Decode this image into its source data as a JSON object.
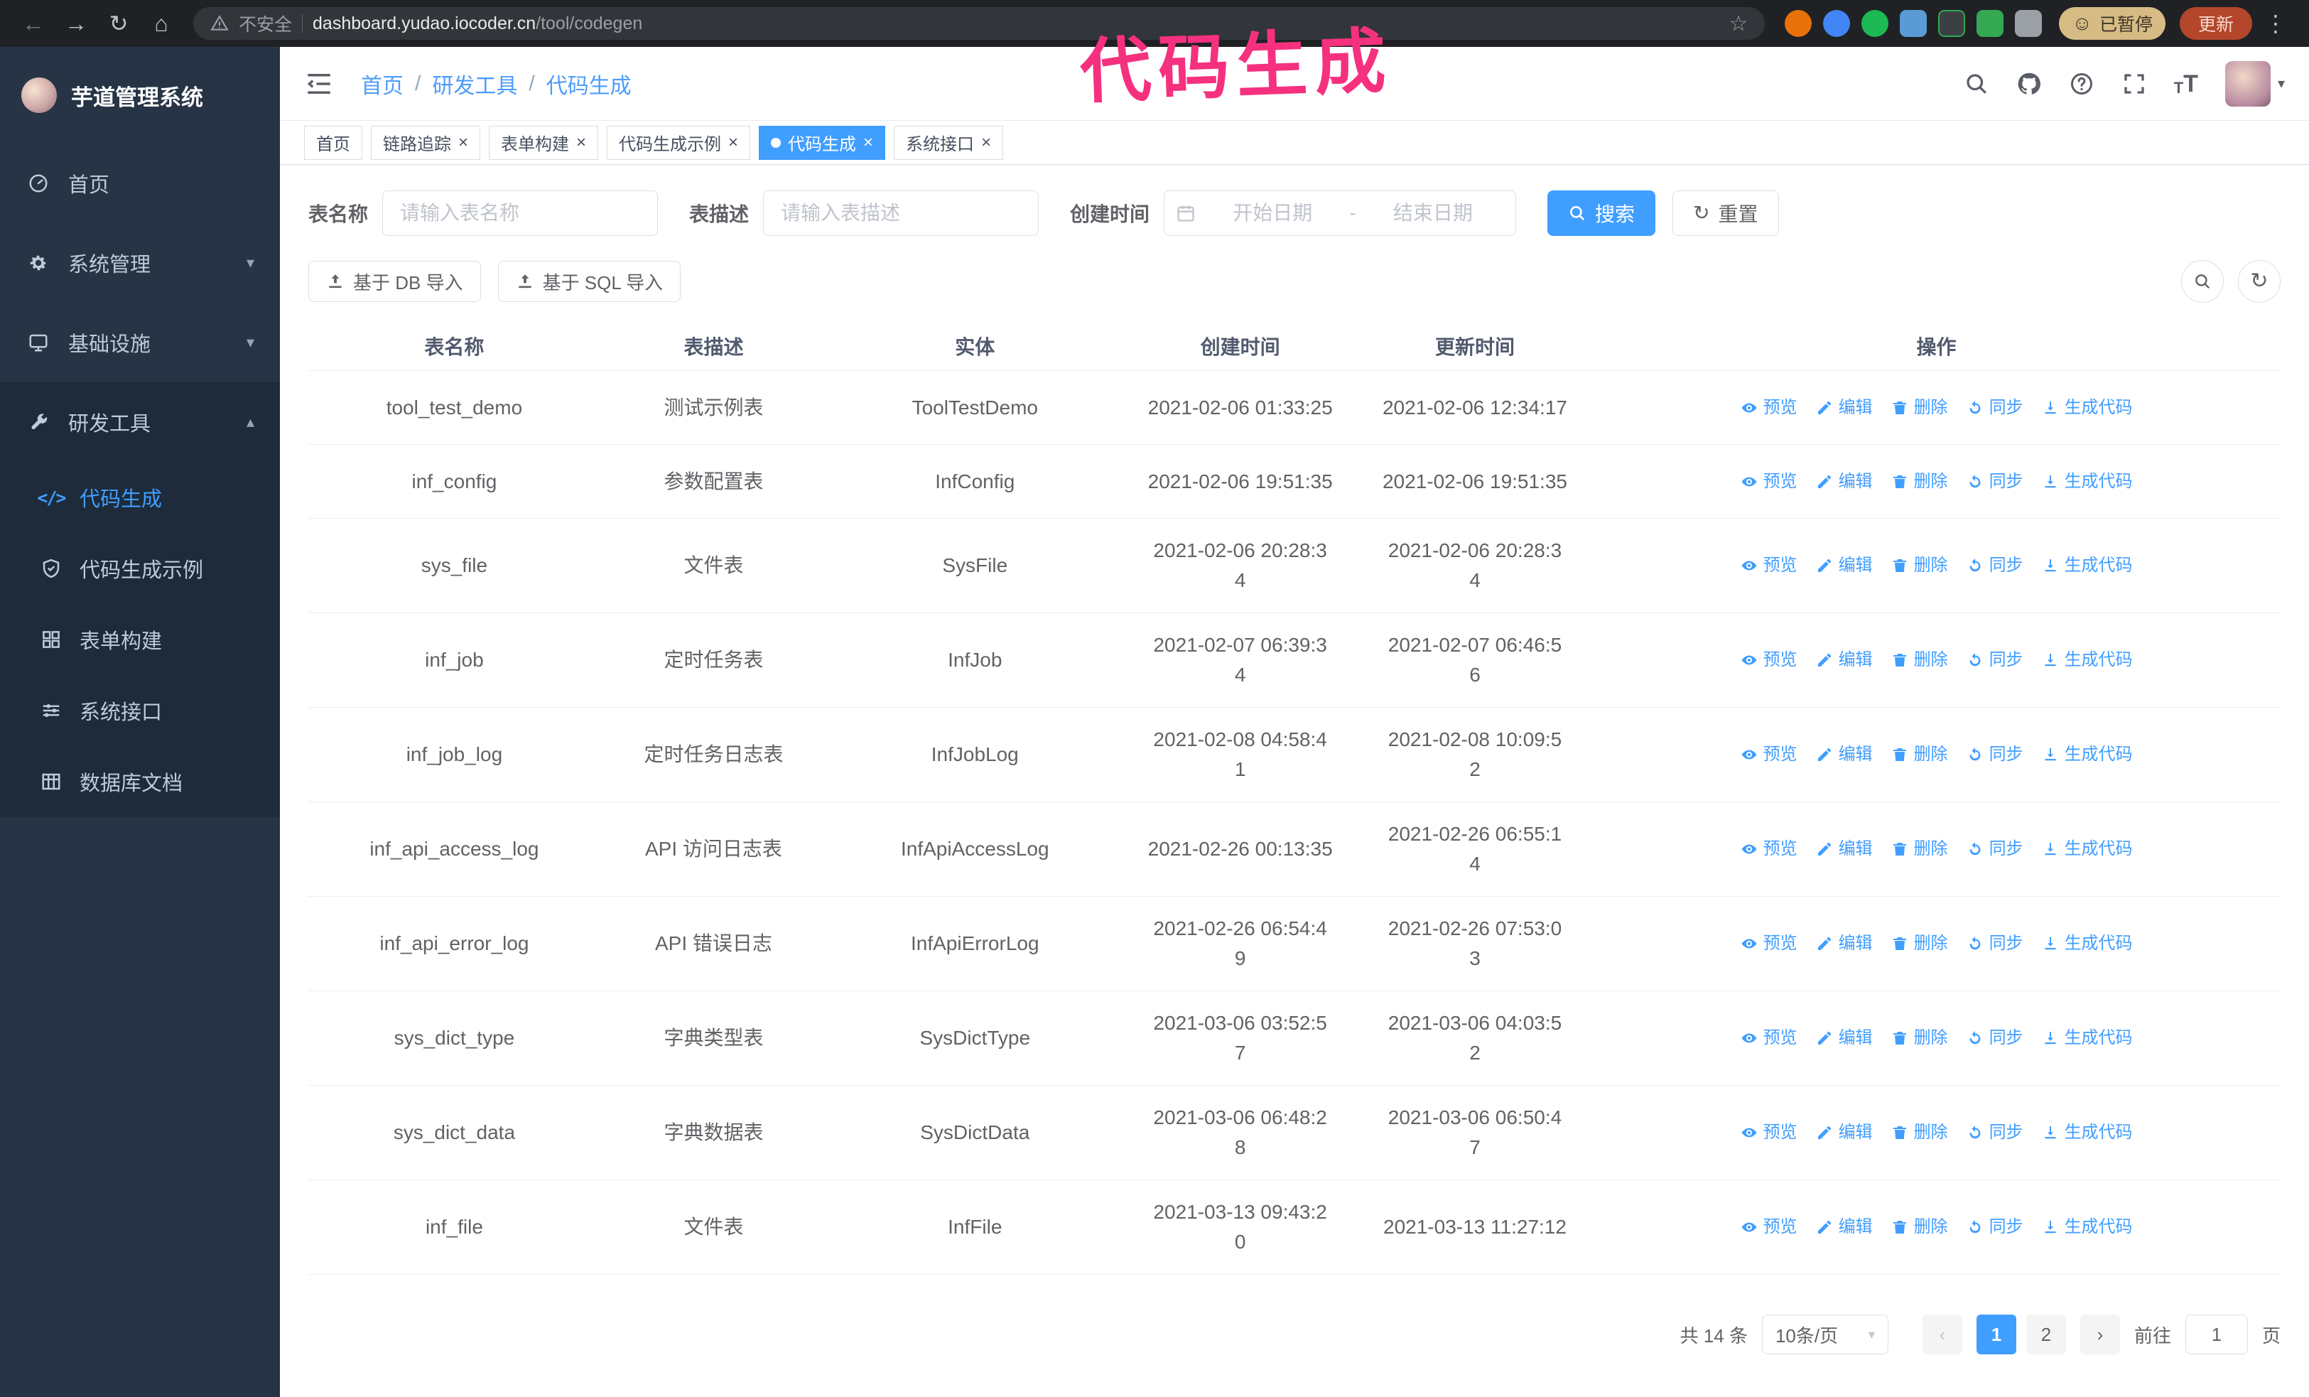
{
  "browser": {
    "security_label": "不安全",
    "url_domain": "dashboard.yudao.iocoder.cn",
    "url_path": "/tool/codegen",
    "paused_badge": "已暂停",
    "update_button": "更新"
  },
  "annotation": {
    "text": "代码生成",
    "color": "#f5317f"
  },
  "sidebar": {
    "logo_title": "芋道管理系统",
    "items": [
      {
        "label": "首页",
        "icon": "dashboard-icon"
      },
      {
        "label": "系统管理",
        "icon": "gear-icon",
        "chevron": "down"
      },
      {
        "label": "基础设施",
        "icon": "monitor-icon",
        "chevron": "down"
      },
      {
        "label": "研发工具",
        "icon": "tools-icon",
        "chevron": "up",
        "expanded": true,
        "children": [
          {
            "label": "代码生成",
            "icon": "code-icon",
            "active": true
          },
          {
            "label": "代码生成示例",
            "icon": "shield-icon",
            "active": false
          },
          {
            "label": "表单构建",
            "icon": "form-icon",
            "active": false
          },
          {
            "label": "系统接口",
            "icon": "sliders-icon",
            "active": false
          },
          {
            "label": "数据库文档",
            "icon": "table-icon",
            "active": false
          }
        ]
      }
    ]
  },
  "breadcrumb": [
    "首页",
    "研发工具",
    "代码生成"
  ],
  "breadcrumb_separator": "/",
  "tags": [
    {
      "label": "首页",
      "closable": false,
      "active": false
    },
    {
      "label": "链路追踪",
      "closable": true,
      "active": false
    },
    {
      "label": "表单构建",
      "closable": true,
      "active": false
    },
    {
      "label": "代码生成示例",
      "closable": true,
      "active": false
    },
    {
      "label": "代码生成",
      "closable": true,
      "active": true
    },
    {
      "label": "系统接口",
      "closable": true,
      "active": false
    }
  ],
  "filters": {
    "table_name_label": "表名称",
    "table_name_placeholder": "请输入表名称",
    "table_desc_label": "表描述",
    "table_desc_placeholder": "请输入表描述",
    "create_time_label": "创建时间",
    "date_start_placeholder": "开始日期",
    "date_separator": "-",
    "date_end_placeholder": "结束日期",
    "search_button": "搜索",
    "reset_button": "重置"
  },
  "toolbar": {
    "import_db": "基于 DB 导入",
    "import_sql": "基于 SQL 导入"
  },
  "table": {
    "columns": [
      "表名称",
      "表描述",
      "实体",
      "创建时间",
      "更新时间",
      "操作"
    ],
    "actions": [
      {
        "label": "预览",
        "icon": "eye-icon"
      },
      {
        "label": "编辑",
        "icon": "edit-icon"
      },
      {
        "label": "删除",
        "icon": "delete-icon"
      },
      {
        "label": "同步",
        "icon": "sync-icon"
      },
      {
        "label": "生成代码",
        "icon": "download-icon"
      }
    ],
    "rows": [
      {
        "name": "tool_test_demo",
        "desc": "测试示例表",
        "entity": "ToolTestDemo",
        "created": "2021-02-06 01:33:25",
        "updated": "2021-02-06 12:34:17"
      },
      {
        "name": "inf_config",
        "desc": "参数配置表",
        "entity": "InfConfig",
        "created": "2021-02-06 19:51:35",
        "updated": "2021-02-06 19:51:35"
      },
      {
        "name": "sys_file",
        "desc": "文件表",
        "entity": "SysFile",
        "created": "2021-02-06 20:28:3\n4",
        "updated": "2021-02-06 20:28:3\n4"
      },
      {
        "name": "inf_job",
        "desc": "定时任务表",
        "entity": "InfJob",
        "created": "2021-02-07 06:39:3\n4",
        "updated": "2021-02-07 06:46:5\n6"
      },
      {
        "name": "inf_job_log",
        "desc": "定时任务日志表",
        "entity": "InfJobLog",
        "created": "2021-02-08 04:58:4\n1",
        "updated": "2021-02-08 10:09:5\n2"
      },
      {
        "name": "inf_api_access_log",
        "desc": "API 访问日志表",
        "entity": "InfApiAccessLog",
        "created": "2021-02-26 00:13:35",
        "updated": "2021-02-26 06:55:1\n4"
      },
      {
        "name": "inf_api_error_log",
        "desc": "API 错误日志",
        "entity": "InfApiErrorLog",
        "created": "2021-02-26 06:54:4\n9",
        "updated": "2021-02-26 07:53:0\n3"
      },
      {
        "name": "sys_dict_type",
        "desc": "字典类型表",
        "entity": "SysDictType",
        "created": "2021-03-06 03:52:5\n7",
        "updated": "2021-03-06 04:03:5\n2"
      },
      {
        "name": "sys_dict_data",
        "desc": "字典数据表",
        "entity": "SysDictData",
        "created": "2021-03-06 06:48:2\n8",
        "updated": "2021-03-06 06:50:4\n7"
      },
      {
        "name": "inf_file",
        "desc": "文件表",
        "entity": "InfFile",
        "created": "2021-03-13 09:43:2\n0",
        "updated": "2021-03-13 11:27:12"
      }
    ]
  },
  "pagination": {
    "total": "共 14 条",
    "page_size": "10条/页",
    "pages": [
      "1",
      "2"
    ],
    "active_page": "1",
    "goto_label": "前往",
    "goto_value": "1",
    "goto_suffix": "页"
  }
}
